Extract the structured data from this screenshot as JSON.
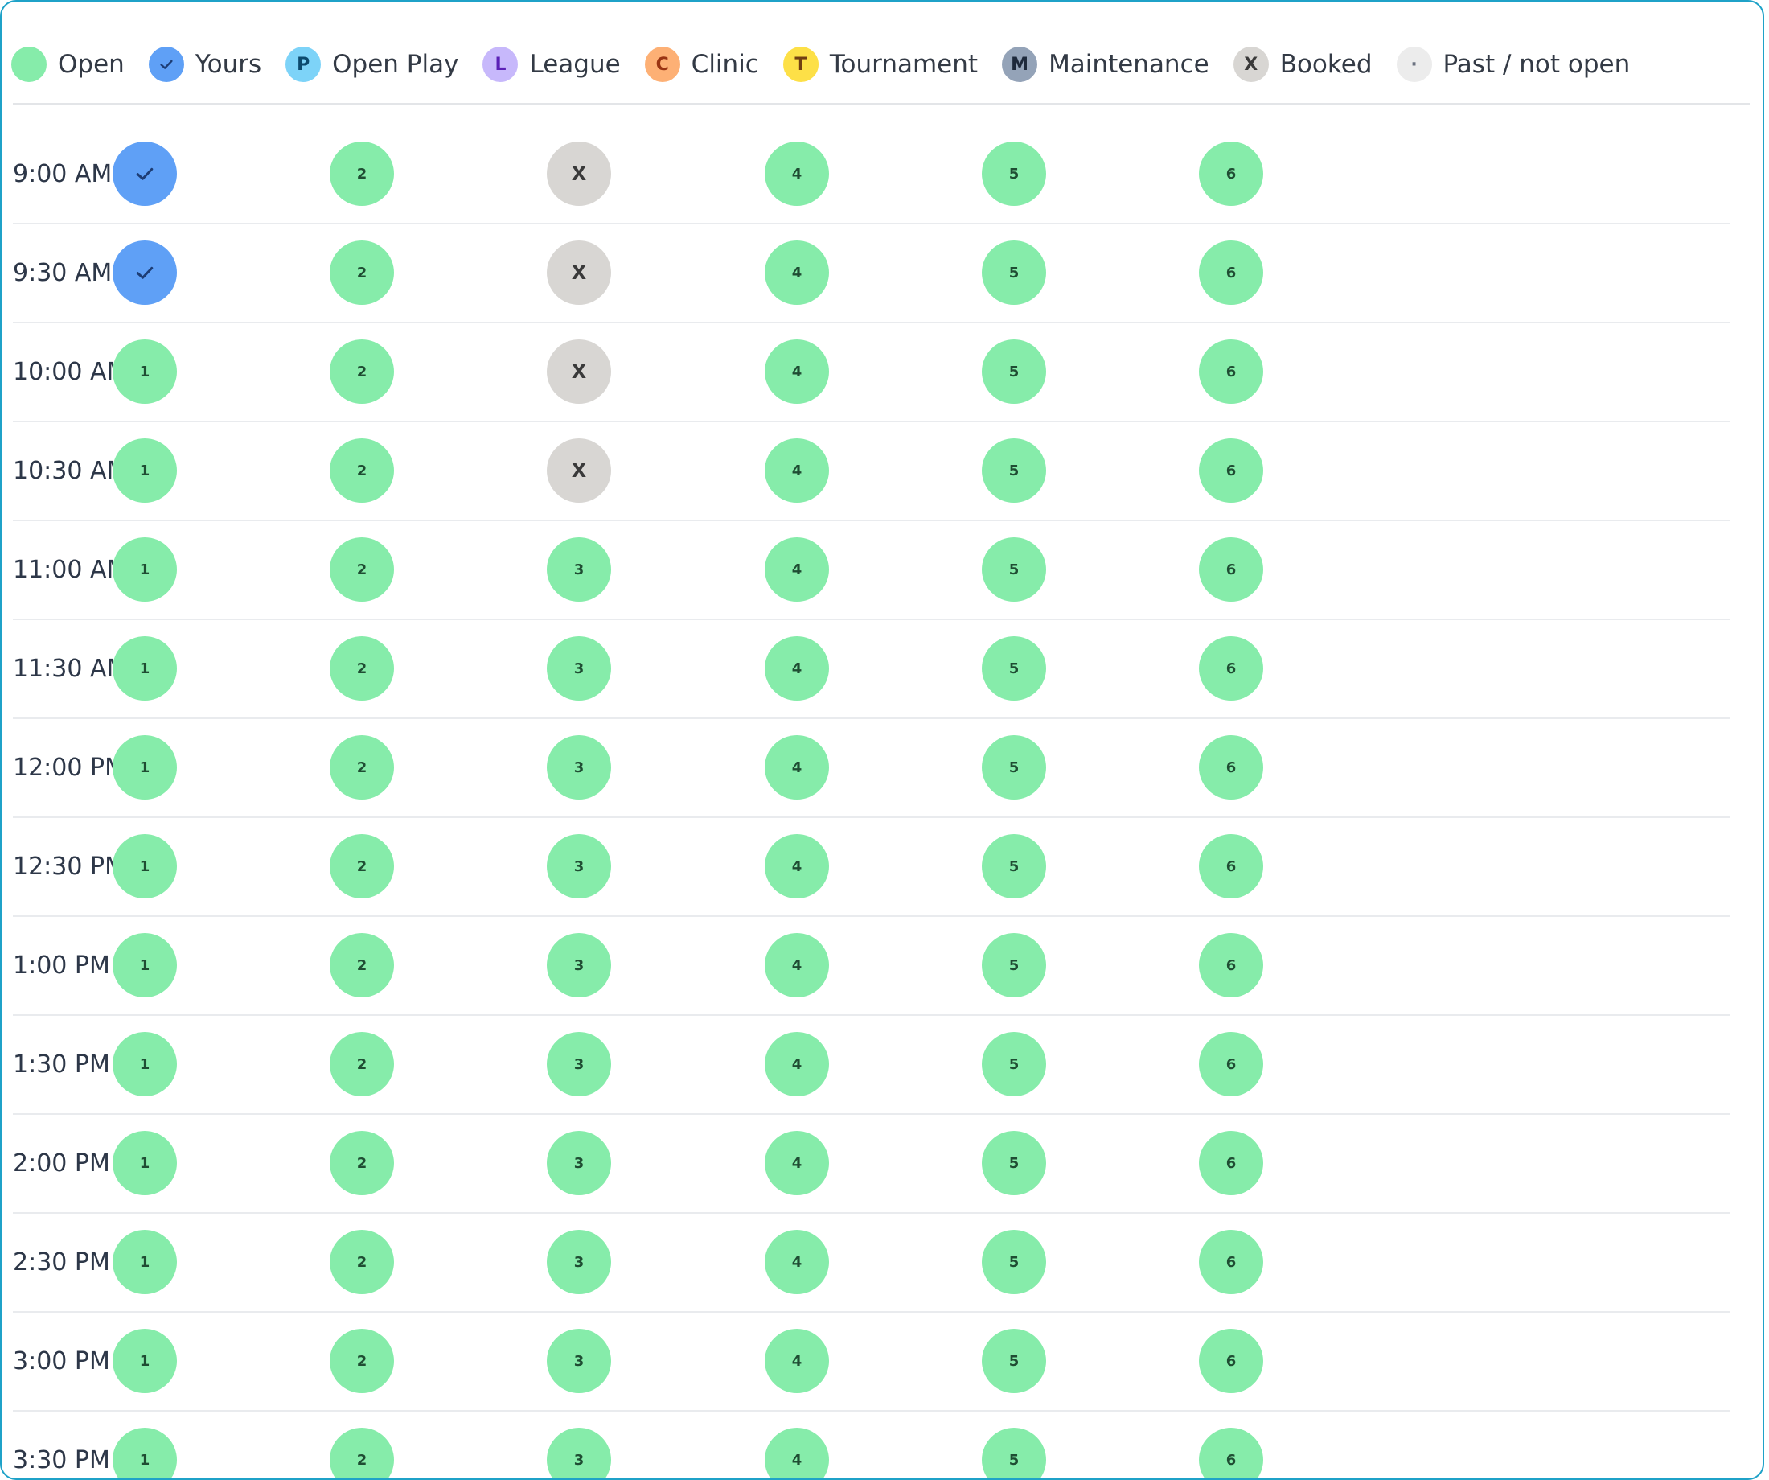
{
  "legend": [
    {
      "key": "open",
      "label": "Open",
      "glyph": "",
      "bg": "#86ecaa",
      "fg": "#1f4d33",
      "border": "#86ecaa"
    },
    {
      "key": "yours",
      "label": "Yours",
      "glyph": "check",
      "bg": "#5fa0f6",
      "fg": "#1d3d75",
      "border": "#5fa0f6"
    },
    {
      "key": "open_play",
      "label": "Open Play",
      "glyph": "P",
      "bg": "#7dd3f8",
      "fg": "#0c4a6e",
      "border": "#7dd3f8"
    },
    {
      "key": "league",
      "label": "League",
      "glyph": "L",
      "bg": "#c7b8fb",
      "fg": "#5b21b6",
      "border": "#c7b8fb"
    },
    {
      "key": "clinic",
      "label": "Clinic",
      "glyph": "C",
      "bg": "#fdb075",
      "fg": "#9a3412",
      "border": "#fdb075"
    },
    {
      "key": "tournament",
      "label": "Tournament",
      "glyph": "T",
      "bg": "#fde047",
      "fg": "#713f12",
      "border": "#fde047"
    },
    {
      "key": "maintenance",
      "label": "Maintenance",
      "glyph": "M",
      "bg": "#94a3b8",
      "fg": "#1e293b",
      "border": "#94a3b8"
    },
    {
      "key": "booked",
      "label": "Booked",
      "glyph": "X",
      "bg": "#d8d6d3",
      "fg": "#3a3a3a",
      "border": "#d8d6d3"
    },
    {
      "key": "past",
      "label": "Past / not open",
      "glyph": "·",
      "bg": "#ececec",
      "fg": "#6b7280",
      "border": "#ececec"
    }
  ],
  "slots": [
    {
      "time": "9:00 AM",
      "courts": [
        {
          "status": "yours",
          "label": "check"
        },
        {
          "status": "open",
          "label": "2"
        },
        {
          "status": "booked",
          "label": "X"
        },
        {
          "status": "open",
          "label": "4"
        },
        {
          "status": "open",
          "label": "5"
        },
        {
          "status": "open",
          "label": "6"
        }
      ]
    },
    {
      "time": "9:30 AM",
      "courts": [
        {
          "status": "yours",
          "label": "check"
        },
        {
          "status": "open",
          "label": "2"
        },
        {
          "status": "booked",
          "label": "X"
        },
        {
          "status": "open",
          "label": "4"
        },
        {
          "status": "open",
          "label": "5"
        },
        {
          "status": "open",
          "label": "6"
        }
      ]
    },
    {
      "time": "10:00 AM",
      "courts": [
        {
          "status": "open",
          "label": "1"
        },
        {
          "status": "open",
          "label": "2"
        },
        {
          "status": "booked",
          "label": "X"
        },
        {
          "status": "open",
          "label": "4"
        },
        {
          "status": "open",
          "label": "5"
        },
        {
          "status": "open",
          "label": "6"
        }
      ]
    },
    {
      "time": "10:30 AM",
      "courts": [
        {
          "status": "open",
          "label": "1"
        },
        {
          "status": "open",
          "label": "2"
        },
        {
          "status": "booked",
          "label": "X"
        },
        {
          "status": "open",
          "label": "4"
        },
        {
          "status": "open",
          "label": "5"
        },
        {
          "status": "open",
          "label": "6"
        }
      ]
    },
    {
      "time": "11:00 AM",
      "courts": [
        {
          "status": "open",
          "label": "1"
        },
        {
          "status": "open",
          "label": "2"
        },
        {
          "status": "open",
          "label": "3"
        },
        {
          "status": "open",
          "label": "4"
        },
        {
          "status": "open",
          "label": "5"
        },
        {
          "status": "open",
          "label": "6"
        }
      ]
    },
    {
      "time": "11:30 AM",
      "courts": [
        {
          "status": "open",
          "label": "1"
        },
        {
          "status": "open",
          "label": "2"
        },
        {
          "status": "open",
          "label": "3"
        },
        {
          "status": "open",
          "label": "4"
        },
        {
          "status": "open",
          "label": "5"
        },
        {
          "status": "open",
          "label": "6"
        }
      ]
    },
    {
      "time": "12:00 PM",
      "courts": [
        {
          "status": "open",
          "label": "1"
        },
        {
          "status": "open",
          "label": "2"
        },
        {
          "status": "open",
          "label": "3"
        },
        {
          "status": "open",
          "label": "4"
        },
        {
          "status": "open",
          "label": "5"
        },
        {
          "status": "open",
          "label": "6"
        }
      ]
    },
    {
      "time": "12:30 PM",
      "courts": [
        {
          "status": "open",
          "label": "1"
        },
        {
          "status": "open",
          "label": "2"
        },
        {
          "status": "open",
          "label": "3"
        },
        {
          "status": "open",
          "label": "4"
        },
        {
          "status": "open",
          "label": "5"
        },
        {
          "status": "open",
          "label": "6"
        }
      ]
    },
    {
      "time": "1:00 PM",
      "courts": [
        {
          "status": "open",
          "label": "1"
        },
        {
          "status": "open",
          "label": "2"
        },
        {
          "status": "open",
          "label": "3"
        },
        {
          "status": "open",
          "label": "4"
        },
        {
          "status": "open",
          "label": "5"
        },
        {
          "status": "open",
          "label": "6"
        }
      ]
    },
    {
      "time": "1:30 PM",
      "courts": [
        {
          "status": "open",
          "label": "1"
        },
        {
          "status": "open",
          "label": "2"
        },
        {
          "status": "open",
          "label": "3"
        },
        {
          "status": "open",
          "label": "4"
        },
        {
          "status": "open",
          "label": "5"
        },
        {
          "status": "open",
          "label": "6"
        }
      ]
    },
    {
      "time": "2:00 PM",
      "courts": [
        {
          "status": "open",
          "label": "1"
        },
        {
          "status": "open",
          "label": "2"
        },
        {
          "status": "open",
          "label": "3"
        },
        {
          "status": "open",
          "label": "4"
        },
        {
          "status": "open",
          "label": "5"
        },
        {
          "status": "open",
          "label": "6"
        }
      ]
    },
    {
      "time": "2:30 PM",
      "courts": [
        {
          "status": "open",
          "label": "1"
        },
        {
          "status": "open",
          "label": "2"
        },
        {
          "status": "open",
          "label": "3"
        },
        {
          "status": "open",
          "label": "4"
        },
        {
          "status": "open",
          "label": "5"
        },
        {
          "status": "open",
          "label": "6"
        }
      ]
    },
    {
      "time": "3:00 PM",
      "courts": [
        {
          "status": "open",
          "label": "1"
        },
        {
          "status": "open",
          "label": "2"
        },
        {
          "status": "open",
          "label": "3"
        },
        {
          "status": "open",
          "label": "4"
        },
        {
          "status": "open",
          "label": "5"
        },
        {
          "status": "open",
          "label": "6"
        }
      ]
    },
    {
      "time": "3:30 PM",
      "courts": [
        {
          "status": "open",
          "label": "1"
        },
        {
          "status": "open",
          "label": "2"
        },
        {
          "status": "open",
          "label": "3"
        },
        {
          "status": "open",
          "label": "4"
        },
        {
          "status": "open",
          "label": "5"
        },
        {
          "status": "open",
          "label": "6"
        }
      ]
    }
  ]
}
